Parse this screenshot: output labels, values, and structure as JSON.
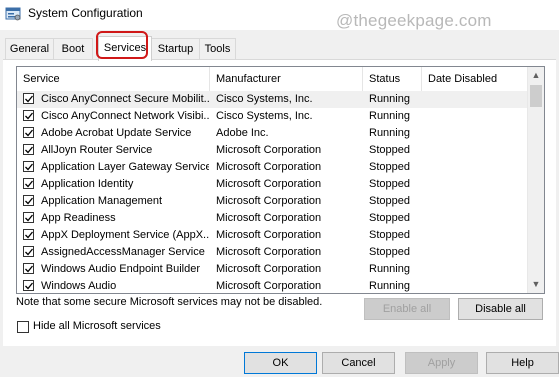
{
  "window": {
    "title": "System Configuration",
    "watermark": "@thegeekpage.com",
    "icon": "msconfig-icon"
  },
  "tabs": [
    {
      "label": "General",
      "active": false
    },
    {
      "label": "Boot",
      "active": false
    },
    {
      "label": "Services",
      "active": true
    },
    {
      "label": "Startup",
      "active": false
    },
    {
      "label": "Tools",
      "active": false
    }
  ],
  "highlight_color": "#d01818",
  "columns": [
    "Service",
    "Manufacturer",
    "Status",
    "Date Disabled"
  ],
  "services": [
    {
      "name": "Cisco AnyConnect Secure Mobilit...",
      "manufacturer": "Cisco Systems, Inc.",
      "status": "Running",
      "date_disabled": "",
      "checked": true
    },
    {
      "name": "Cisco AnyConnect Network Visibi...",
      "manufacturer": "Cisco Systems, Inc.",
      "status": "Running",
      "date_disabled": "",
      "checked": true
    },
    {
      "name": "Adobe Acrobat Update Service",
      "manufacturer": "Adobe Inc.",
      "status": "Running",
      "date_disabled": "",
      "checked": true
    },
    {
      "name": "AllJoyn Router Service",
      "manufacturer": "Microsoft Corporation",
      "status": "Stopped",
      "date_disabled": "",
      "checked": true
    },
    {
      "name": "Application Layer Gateway Service",
      "manufacturer": "Microsoft Corporation",
      "status": "Stopped",
      "date_disabled": "",
      "checked": true
    },
    {
      "name": "Application Identity",
      "manufacturer": "Microsoft Corporation",
      "status": "Stopped",
      "date_disabled": "",
      "checked": true
    },
    {
      "name": "Application Management",
      "manufacturer": "Microsoft Corporation",
      "status": "Stopped",
      "date_disabled": "",
      "checked": true
    },
    {
      "name": "App Readiness",
      "manufacturer": "Microsoft Corporation",
      "status": "Stopped",
      "date_disabled": "",
      "checked": true
    },
    {
      "name": "AppX Deployment Service (AppX...",
      "manufacturer": "Microsoft Corporation",
      "status": "Stopped",
      "date_disabled": "",
      "checked": true
    },
    {
      "name": "AssignedAccessManager Service",
      "manufacturer": "Microsoft Corporation",
      "status": "Stopped",
      "date_disabled": "",
      "checked": true
    },
    {
      "name": "Windows Audio Endpoint Builder",
      "manufacturer": "Microsoft Corporation",
      "status": "Running",
      "date_disabled": "",
      "checked": true
    },
    {
      "name": "Windows Audio",
      "manufacturer": "Microsoft Corporation",
      "status": "Running",
      "date_disabled": "",
      "checked": true
    }
  ],
  "note": "Note that some secure Microsoft services may not be disabled.",
  "enable_all": "Enable all",
  "disable_all": "Disable all",
  "hide_ms_label": "Hide all Microsoft services",
  "hide_ms_checked": false,
  "buttons": {
    "ok": "OK",
    "cancel": "Cancel",
    "apply": "Apply",
    "help": "Help"
  }
}
